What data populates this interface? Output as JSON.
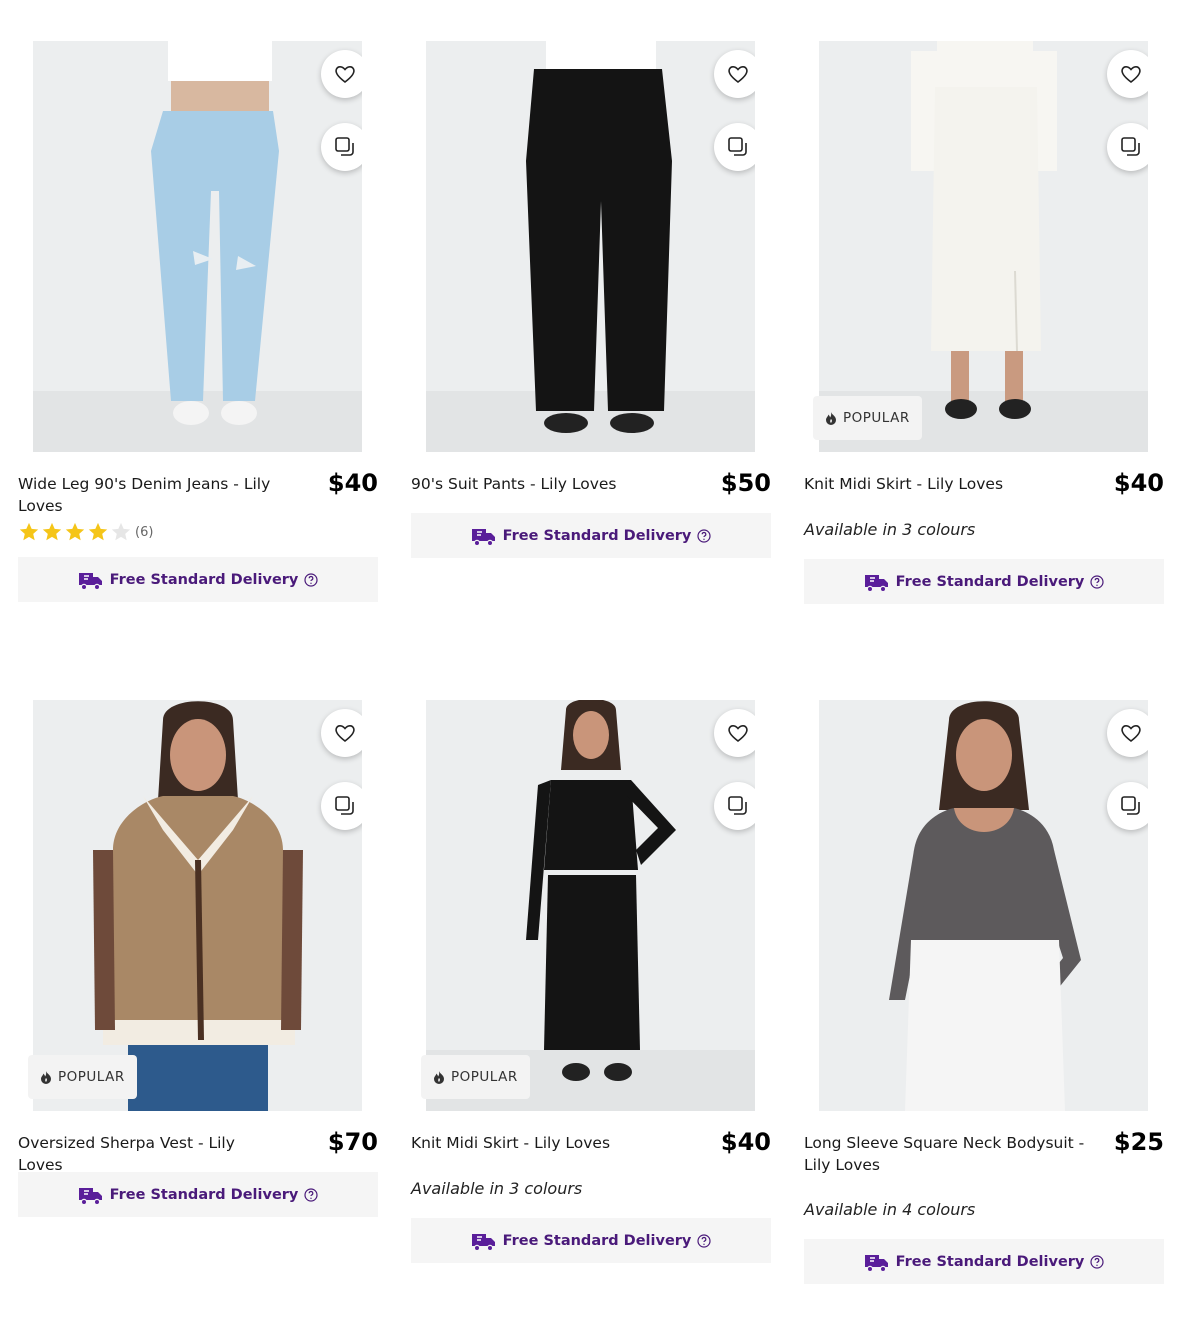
{
  "colors": {
    "brand_purple": "#5a1e9a",
    "delivery_text": "#4a1a7a",
    "star": "#f5c518"
  },
  "products": [
    {
      "title": "Wide Leg 90's Denim Jeans - Lily Loves",
      "price": "$40",
      "rating": 4,
      "rating_count": "(6)",
      "badge": "",
      "colours": "",
      "delivery": "Free Standard Delivery"
    },
    {
      "title": "90's Suit Pants - Lily Loves",
      "price": "$50",
      "badge": "",
      "colours": "",
      "delivery": "Free Standard Delivery"
    },
    {
      "title": "Knit Midi Skirt - Lily Loves",
      "price": "$40",
      "badge": "POPULAR",
      "colours": "Available in 3 colours",
      "delivery": "Free Standard Delivery"
    },
    {
      "title": "Oversized Sherpa Vest - Lily Loves",
      "price": "$70",
      "badge": "POPULAR",
      "colours": "",
      "delivery": "Free Standard Delivery"
    },
    {
      "title": "Knit Midi Skirt - Lily Loves",
      "price": "$40",
      "badge": "POPULAR",
      "colours": "Available in 3 colours",
      "delivery": "Free Standard Delivery"
    },
    {
      "title": "Long Sleeve Square Neck Bodysuit - Lily Loves",
      "price": "$25",
      "badge": "",
      "colours": "Available in 4 colours",
      "delivery": "Free Standard Delivery"
    }
  ]
}
